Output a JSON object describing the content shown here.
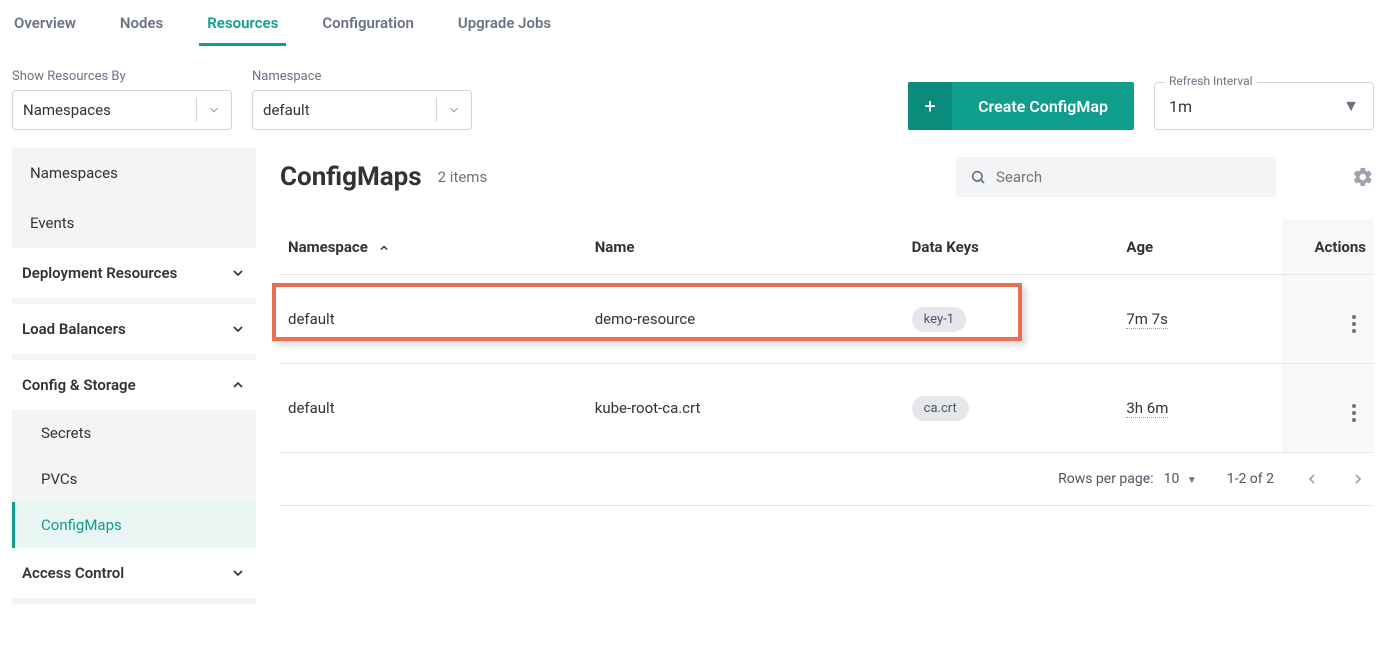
{
  "tabs": {
    "overview": "Overview",
    "nodes": "Nodes",
    "resources": "Resources",
    "configuration": "Configuration",
    "upgrade_jobs": "Upgrade Jobs"
  },
  "filters": {
    "show_by_label": "Show Resources By",
    "show_by_value": "Namespaces",
    "namespace_label": "Namespace",
    "namespace_value": "default"
  },
  "create_button": "Create ConfigMap",
  "refresh": {
    "label": "Refresh Interval",
    "value": "1m"
  },
  "sidebar": {
    "namespaces": "Namespaces",
    "events": "Events",
    "deployment_resources": "Deployment Resources",
    "load_balancers": "Load Balancers",
    "config_storage": "Config & Storage",
    "secrets": "Secrets",
    "pvcs": "PVCs",
    "configmaps": "ConfigMaps",
    "access_control": "Access Control"
  },
  "main": {
    "title": "ConfigMaps",
    "count": "2 items",
    "search_placeholder": "Search"
  },
  "table": {
    "headers": {
      "namespace": "Namespace",
      "name": "Name",
      "data_keys": "Data Keys",
      "age": "Age",
      "actions": "Actions"
    },
    "rows": [
      {
        "namespace": "default",
        "name": "demo-resource",
        "key": "key-1",
        "age": "7m 7s"
      },
      {
        "namespace": "default",
        "name": "kube-root-ca.crt",
        "key": "ca.crt",
        "age": "3h 6m"
      }
    ]
  },
  "pagination": {
    "rows_per_page_label": "Rows per page:",
    "rows_per_page_value": "10",
    "range": "1-2 of 2"
  }
}
